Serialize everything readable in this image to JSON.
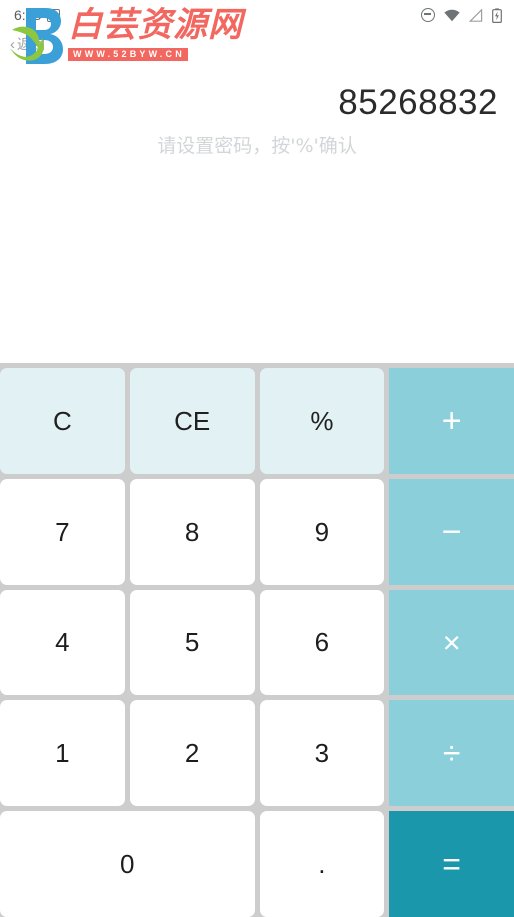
{
  "status_bar": {
    "clock": "6:38",
    "alarm_badge": "A",
    "icons": [
      {
        "name": "do-not-disturb-icon",
        "label": "Do not disturb"
      },
      {
        "name": "wifi-icon",
        "label": "Wi-Fi"
      },
      {
        "name": "signal-icon",
        "label": "Cellular signal"
      },
      {
        "name": "battery-charging-icon",
        "label": "Battery charging"
      }
    ]
  },
  "navigation": {
    "back_label": "返回",
    "back_chevron": "‹"
  },
  "watermark": {
    "site_name": "白芸资源网",
    "site_url": "WWW.52BYW.CN",
    "logo_letter": "B",
    "brand_color": "#f2675f",
    "logo_blue": "#3b9fd8",
    "logo_green": "#8dc63f"
  },
  "display": {
    "value": "85268832",
    "hint": "请设置密码，按'%'确认"
  },
  "keypad": {
    "colors": {
      "number_bg": "#ffffff",
      "function_bg": "#e2f2f4",
      "operator_bg": "#8bcfdb",
      "equals_bg": "#1b97ac",
      "gap": "#cdcdcd",
      "number_text": "#1d1d1d",
      "operator_text": "#ffffff"
    },
    "rows": [
      [
        {
          "key": "clear-all-button",
          "label": "C",
          "type": "func"
        },
        {
          "key": "clear-entry-button",
          "label": "CE",
          "type": "func"
        },
        {
          "key": "percent-button",
          "label": "%",
          "type": "func"
        },
        {
          "key": "plus-button",
          "label": "+",
          "type": "op",
          "glyph": "plus"
        }
      ],
      [
        {
          "key": "digit-7-button",
          "label": "7",
          "type": "num"
        },
        {
          "key": "digit-8-button",
          "label": "8",
          "type": "num"
        },
        {
          "key": "digit-9-button",
          "label": "9",
          "type": "num"
        },
        {
          "key": "minus-button",
          "label": "−",
          "type": "op",
          "glyph": "minus"
        }
      ],
      [
        {
          "key": "digit-4-button",
          "label": "4",
          "type": "num"
        },
        {
          "key": "digit-5-button",
          "label": "5",
          "type": "num"
        },
        {
          "key": "digit-6-button",
          "label": "6",
          "type": "num"
        },
        {
          "key": "multiply-button",
          "label": "×",
          "type": "op",
          "glyph": "times"
        }
      ],
      [
        {
          "key": "digit-1-button",
          "label": "1",
          "type": "num"
        },
        {
          "key": "digit-2-button",
          "label": "2",
          "type": "num"
        },
        {
          "key": "digit-3-button",
          "label": "3",
          "type": "num"
        },
        {
          "key": "divide-button",
          "label": "÷",
          "type": "op",
          "glyph": "divide"
        }
      ],
      [
        {
          "key": "digit-0-button",
          "label": "0",
          "type": "num",
          "wide": true
        },
        {
          "key": "decimal-point-button",
          "label": ".",
          "type": "num"
        },
        {
          "key": "equals-button",
          "label": "=",
          "type": "eq",
          "glyph": "equals"
        }
      ]
    ]
  }
}
